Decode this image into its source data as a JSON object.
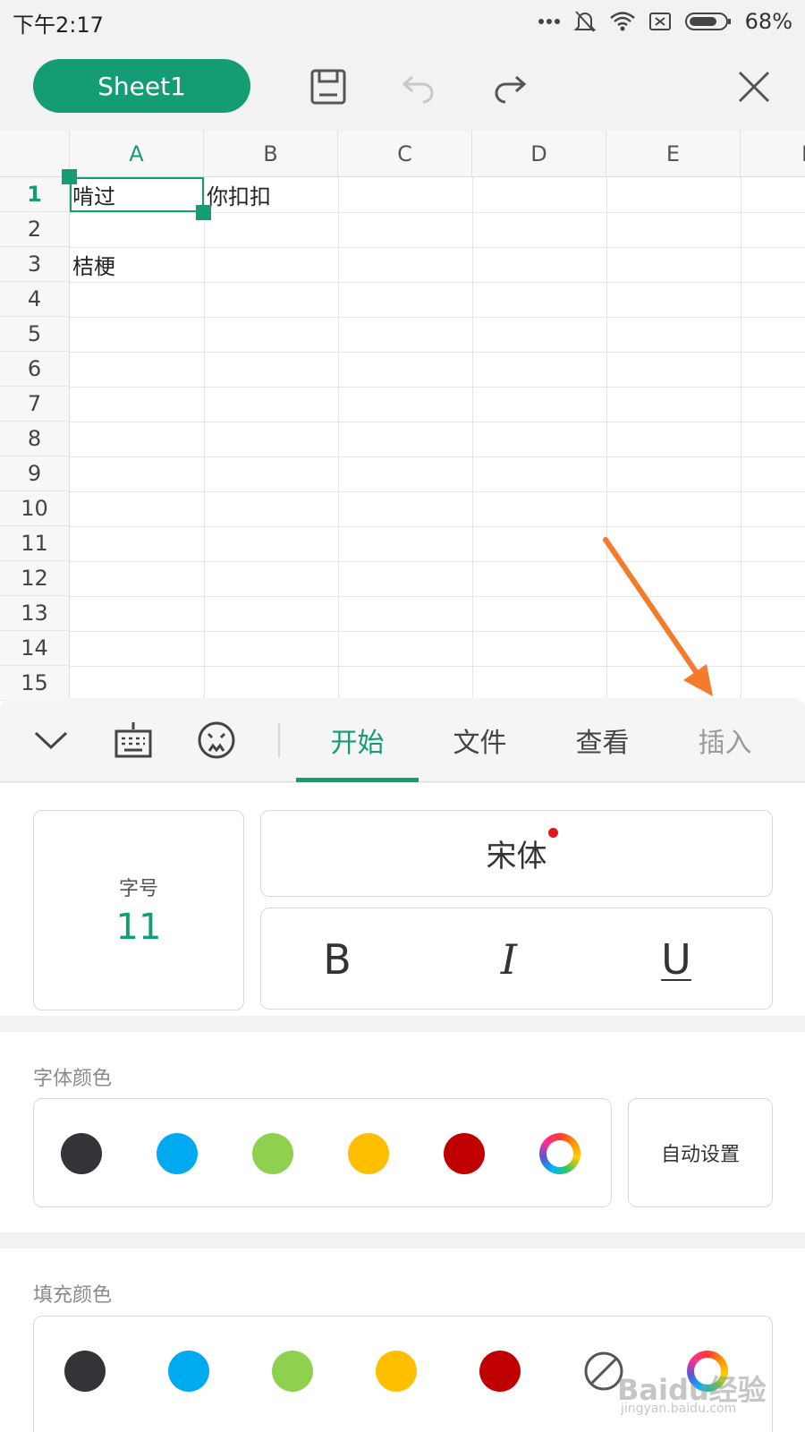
{
  "status_bar": {
    "time": "下午2:17",
    "battery": "68%",
    "icons": [
      "more-dots-icon",
      "bell-off-icon",
      "wifi-icon",
      "sim-off-icon",
      "battery-icon"
    ]
  },
  "toolbar": {
    "sheet_name": "Sheet1",
    "icons": [
      "save-icon",
      "undo-icon",
      "redo-icon",
      "close-icon"
    ]
  },
  "sheet": {
    "columns": [
      "A",
      "B",
      "C",
      "D",
      "E",
      "F"
    ],
    "rows": [
      "1",
      "2",
      "3",
      "4",
      "5",
      "6",
      "7",
      "8",
      "9",
      "10",
      "11",
      "12",
      "13",
      "14",
      "15"
    ],
    "cells": {
      "a1": "啃过",
      "b1": "你扣扣",
      "a3": "桔梗"
    },
    "selected_cell": "A1"
  },
  "panel": {
    "tabs": [
      "开始",
      "文件",
      "查看",
      "插入"
    ],
    "active_tab": "开始",
    "tab_icons": [
      "collapse-chevron-icon",
      "keyboard-icon",
      "emoji-icon"
    ],
    "font_size_label": "字号",
    "font_size_value": "11",
    "font_name": "宋体",
    "style_buttons": [
      "B",
      "I",
      "U"
    ],
    "font_color": {
      "title": "字体颜色",
      "swatches": [
        "#333438",
        "#00aaf0",
        "#8fd14f",
        "#ffbf00",
        "#c00000"
      ],
      "auto_label": "自动设置"
    },
    "fill_color": {
      "title": "填充颜色",
      "swatches": [
        "#333438",
        "#00aaf0",
        "#8fd14f",
        "#ffbf00",
        "#c00000"
      ]
    }
  },
  "colors": {
    "accent": "#149d74",
    "arrow": "#f47a2c"
  },
  "watermark": {
    "text": "Baidu经验",
    "sub": "jingyan.baidu.com"
  }
}
